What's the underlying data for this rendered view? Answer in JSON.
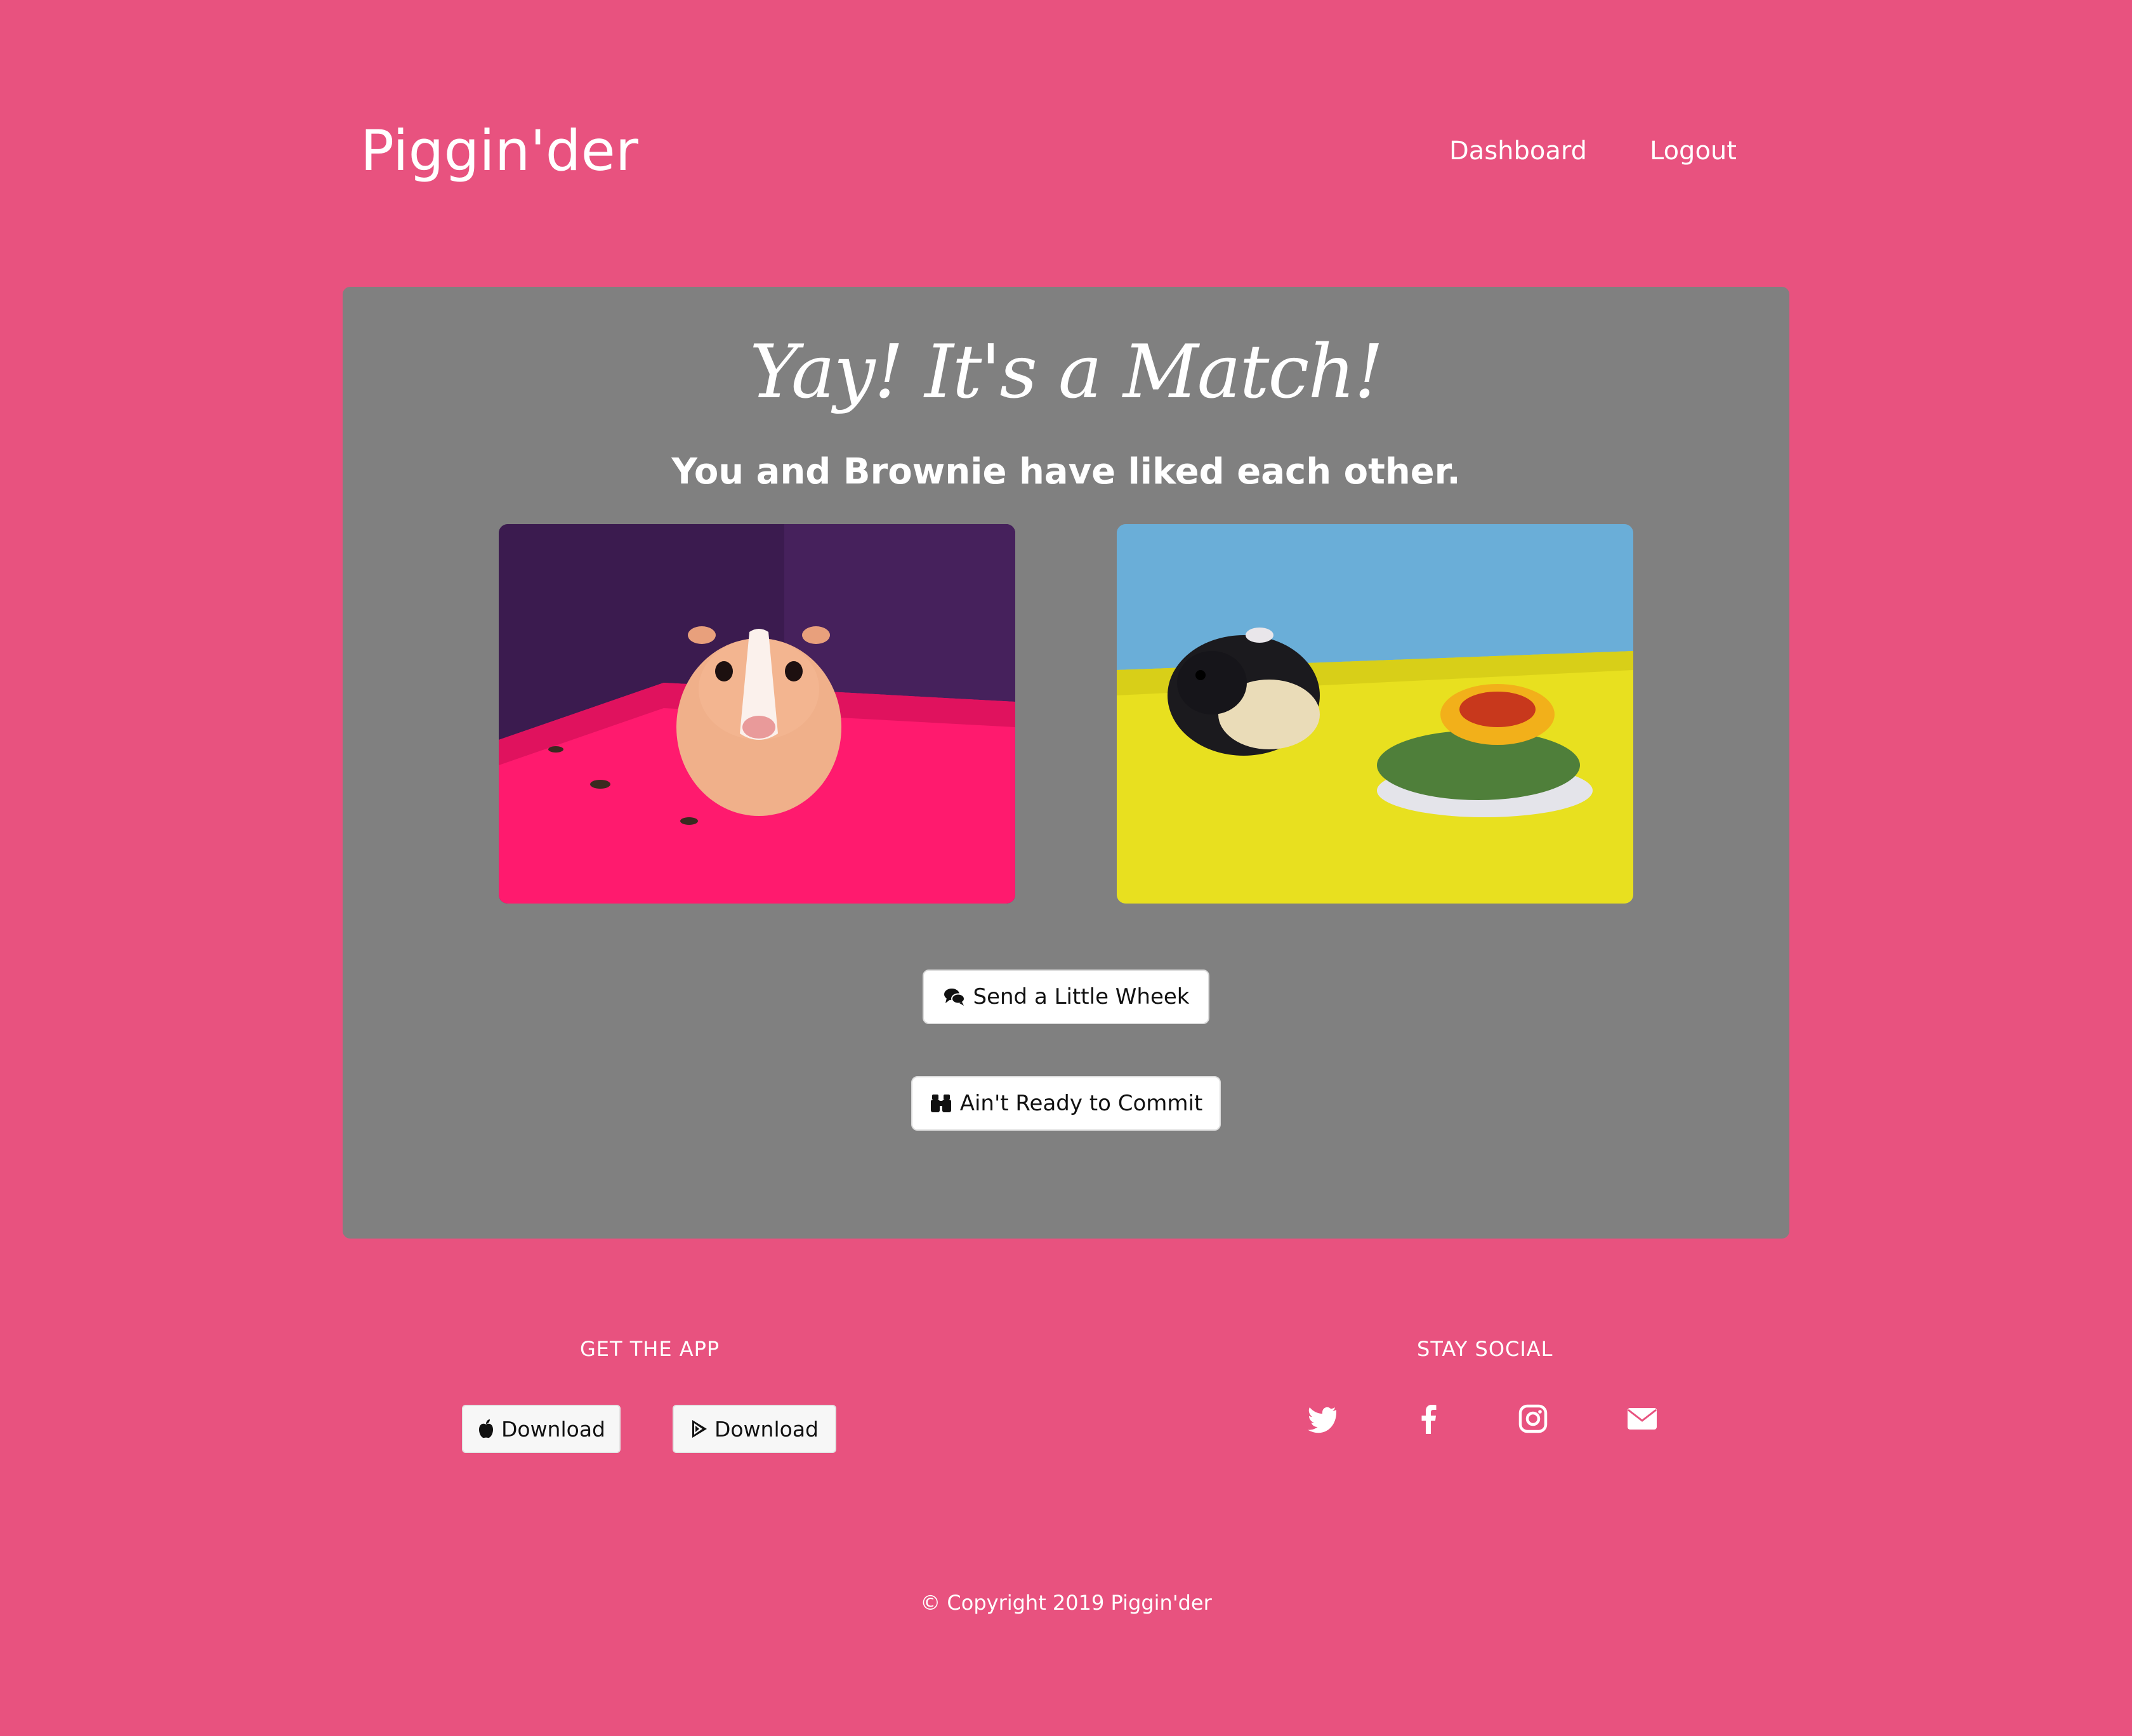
{
  "nav": {
    "brand": "Piggin'der",
    "links": [
      "Dashboard",
      "Logout"
    ]
  },
  "match": {
    "headline": "Yay! It's a Match!",
    "subheading": "You and Brownie have liked each other.",
    "buttons": {
      "message_label": "Send a Little Wheek",
      "message_icon": "comments-icon",
      "decline_label": "Ain't Ready to Commit",
      "decline_icon": "binoculars-icon"
    }
  },
  "footer": {
    "app_heading": "GET THE APP",
    "app_buttons": [
      {
        "label": "Download",
        "icon": "apple-icon"
      },
      {
        "label": "Download",
        "icon": "google-play-icon"
      }
    ],
    "social_heading": "STAY SOCIAL",
    "social_icons": [
      "twitter-icon",
      "facebook-icon",
      "instagram-icon",
      "envelope-icon"
    ],
    "copyright": "© Copyright 2019 Piggin'der"
  },
  "colors": {
    "page_background": "#e8527f",
    "card_background": "#808080",
    "text": "#ffffff"
  }
}
